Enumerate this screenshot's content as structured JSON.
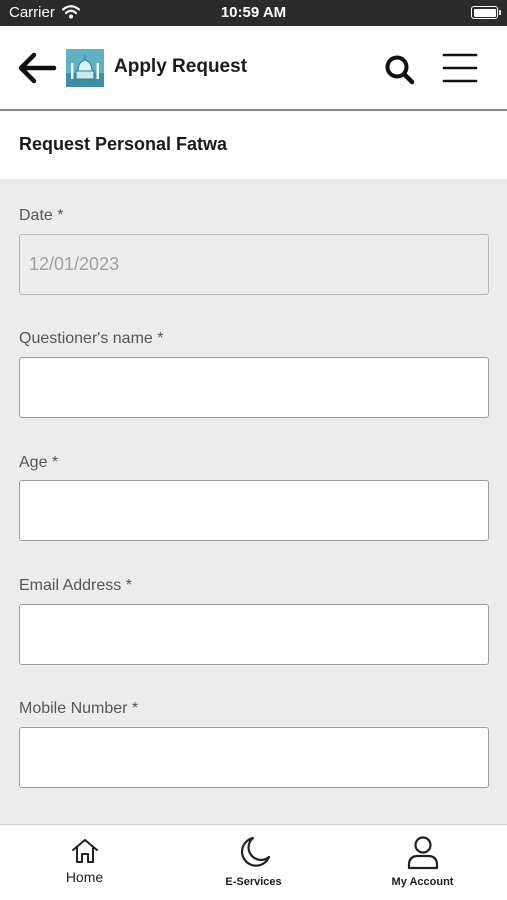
{
  "status_bar": {
    "carrier": "Carrier",
    "time": "10:59 AM"
  },
  "header": {
    "title": "Apply Request",
    "icons": [
      "back-arrow-icon",
      "logo",
      "search-icon",
      "hamburger-menu-icon"
    ]
  },
  "section": {
    "title": "Request Personal Fatwa"
  },
  "form": {
    "date": {
      "label": "Date *",
      "value": "12/01/2023"
    },
    "name": {
      "label": "Questioner's name *",
      "value": ""
    },
    "age": {
      "label": "Age *",
      "value": ""
    },
    "email": {
      "label": "Email Address *",
      "value": ""
    },
    "mobile": {
      "label": "Mobile Number *",
      "value": ""
    }
  },
  "tabbar": {
    "home": {
      "label": "Home",
      "icon": "home-icon"
    },
    "eservices": {
      "label": "E-Services",
      "icon": "crescent-moon-icon"
    },
    "account": {
      "label": "My Account",
      "icon": "user-icon"
    }
  }
}
